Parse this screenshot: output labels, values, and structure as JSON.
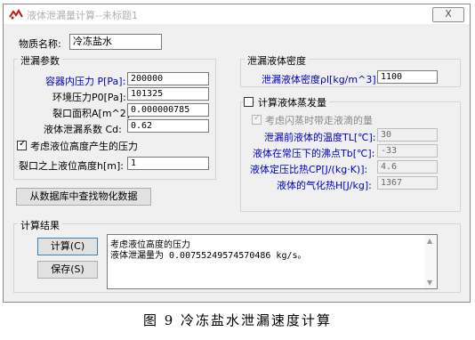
{
  "window": {
    "title": "液体泄漏量计算--未标题1",
    "close_label": "X"
  },
  "material": {
    "label": "物质名称:",
    "value": "冷冻盐水"
  },
  "leak_params": {
    "title": "泄漏参数",
    "fields": [
      {
        "label": "容器内压力 P[Pa]:",
        "value": "200000"
      },
      {
        "label": "环境压力P0[Pa]:",
        "value": "101325"
      },
      {
        "label": "裂口面积A[m^2]:",
        "value": "0.000000785"
      },
      {
        "label": "液体泄漏系数  Cd:",
        "value": "0.62"
      }
    ],
    "height_checkbox_label": "考虑液位高度产生的压力",
    "height_label": "裂口之上液位高度h[m]:",
    "height_value": "1"
  },
  "density": {
    "title": "泄漏液体密度",
    "label": "泄漏液体密度ρl[kg/m^3]:",
    "value": "1100"
  },
  "evaporation": {
    "checkbox_label": "计算液体蒸发量",
    "sub_checkbox_label": "考虑闪蒸时带走液滴的量",
    "fields": [
      {
        "label": "泄漏前液体的温度TL[℃]:",
        "value": "30"
      },
      {
        "label": "液体在常压下的沸点Tb[℃]:",
        "value": "-33"
      },
      {
        "label": "液体定压比热CP[J/(kg·K)]:",
        "value": "4.6"
      },
      {
        "label": "液体的气化热H[J/kg]:",
        "value": "1367"
      }
    ]
  },
  "db_button_label": "从数据库中查找物化数据",
  "results": {
    "title": "计算结果",
    "calc_button": "计算(C)",
    "save_button": "保存(S)",
    "lines": [
      "考虑液位高度的压力",
      "液体泄漏量为 0.00755249574570486 kg/s。"
    ]
  },
  "caption": "图 9  冷冻盐水泄漏速度计算",
  "colors": {
    "label_blue": "#0000c0",
    "window_bg": "#f0f0f0"
  }
}
